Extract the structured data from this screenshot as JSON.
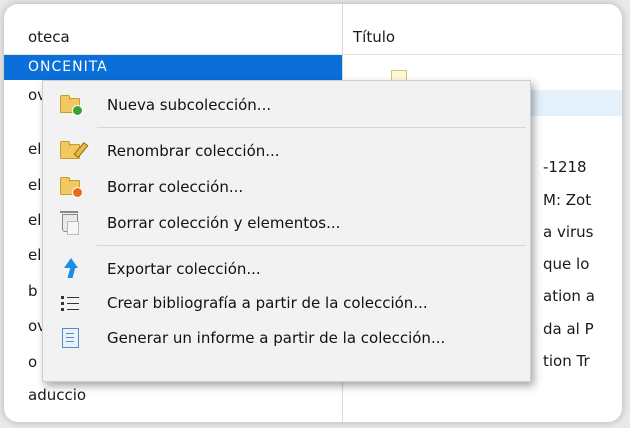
{
  "left_pane": {
    "header": "oteca",
    "selected": "ONCENITA",
    "items": [
      "ov",
      "eli",
      "eli",
      "eli",
      "eli",
      "b",
      "ov",
      "o",
      "aduccio"
    ]
  },
  "right_pane": {
    "header": "Título",
    "items": [
      "-1218",
      "M: Zot",
      "a virus",
      "que lo",
      "ation a",
      "da al P",
      "tion Tr"
    ]
  },
  "context_menu": {
    "items": [
      {
        "label": "Nueva subcolección...",
        "icon": "folder-new-icon"
      },
      {
        "label": "Renombrar colección...",
        "icon": "folder-rename-icon"
      },
      {
        "label": "Borrar colección...",
        "icon": "folder-delete-icon"
      },
      {
        "label": "Borrar colección y elementos...",
        "icon": "trash-icon"
      },
      {
        "label": "Exportar colección...",
        "icon": "export-arrow-icon"
      },
      {
        "label": "Crear bibliografía a partir de la colección...",
        "icon": "bibliography-list-icon"
      },
      {
        "label": "Generar un informe a partir de la colección...",
        "icon": "report-icon"
      }
    ]
  },
  "colors": {
    "selection": "#0a6fd8",
    "menu_bg": "#f2f2f2"
  }
}
